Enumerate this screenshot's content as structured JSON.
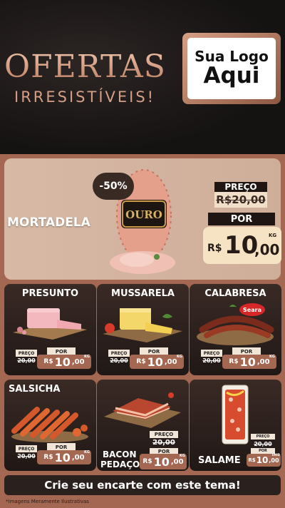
{
  "header": {
    "title": "OFERTAS",
    "subtitle": "IRRESISTÍVEIS!",
    "logo_line1": "Sua Logo",
    "logo_line2": "Aqui"
  },
  "featured": {
    "name": "MORTADELA",
    "discount": "-50%",
    "brand": "OURO",
    "price_label": "PREÇO",
    "old_price": "R$20,00",
    "por_label": "POR",
    "currency": "R$",
    "price_int": "10",
    "price_dec": ",00",
    "unit": "KG"
  },
  "products": [
    {
      "name": "PRESUNTO",
      "preco_label": "PREÇO",
      "old": "20,00",
      "por": "POR",
      "currency": "R$",
      "int": "10",
      "dec": ",00",
      "unit": "KG"
    },
    {
      "name": "MUSSARELA",
      "preco_label": "PREÇO",
      "old": "20,00",
      "por": "POR",
      "currency": "R$",
      "int": "10",
      "dec": ",00",
      "unit": "KG"
    },
    {
      "name": "CALABRESA",
      "brand": "Seara",
      "preco_label": "PREÇO",
      "old": "20,00",
      "por": "POR",
      "currency": "R$",
      "int": "10",
      "dec": ",00",
      "unit": "KG"
    },
    {
      "name": "SALSICHA",
      "preco_label": "PREÇO",
      "old": "20,00",
      "por": "POR",
      "currency": "R$",
      "int": "10",
      "dec": ",00",
      "unit": "KG"
    },
    {
      "name_line1": "BACON",
      "name_line2": "PEDAÇO",
      "preco_label": "PREÇO",
      "old": "20,00",
      "por": "POR",
      "currency": "R$",
      "int": "10",
      "dec": ",00",
      "unit": "KG"
    },
    {
      "name": "SALAME",
      "preco_label": "PREÇO",
      "old": "20,00",
      "por": "POR",
      "currency": "R$",
      "int": "10",
      "dec": ",00",
      "unit": "UNID"
    }
  ],
  "cta": "Crie seu encarte com este tema!",
  "disclaimer": "*Imagens Meramente Ilustrativas",
  "colors": {
    "accent": "#a36752",
    "dark": "#201816",
    "title_gradient": "#d9a589",
    "cream": "#f6e3c3"
  }
}
